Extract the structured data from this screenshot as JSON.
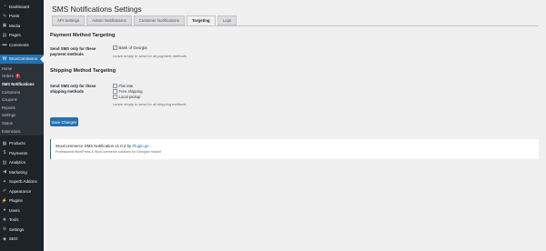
{
  "sidebar": {
    "top_items": [
      {
        "label": "Dashboard",
        "icon": "dashboard-icon",
        "glyph": "◔"
      },
      {
        "label": "Posts",
        "icon": "pushpin-icon",
        "glyph": "✎"
      },
      {
        "label": "Media",
        "icon": "media-icon",
        "glyph": "▣"
      },
      {
        "label": "Pages",
        "icon": "pages-icon",
        "glyph": "▤"
      },
      {
        "label": "Comments",
        "icon": "comments-icon",
        "glyph": "▬"
      }
    ],
    "woocommerce": {
      "label": "WooCommerce",
      "icon": "woo-icon",
      "glyph": "W"
    },
    "woo_submenu": [
      {
        "label": "Home"
      },
      {
        "label": "Orders",
        "badge": "4"
      },
      {
        "label": "SMS Notifications",
        "current": true
      },
      {
        "label": "Customers"
      },
      {
        "label": "Coupons"
      },
      {
        "label": "Reports"
      },
      {
        "label": "Settings"
      },
      {
        "label": "Status"
      },
      {
        "label": "Extensions"
      }
    ],
    "bottom_items": [
      {
        "label": "Products",
        "icon": "products-icon",
        "glyph": "▦"
      },
      {
        "label": "Payments",
        "icon": "payments-icon",
        "glyph": "$"
      },
      {
        "label": "Analytics",
        "icon": "analytics-icon",
        "glyph": "▥"
      },
      {
        "label": "Marketing",
        "icon": "marketing-icon",
        "glyph": "◀"
      },
      {
        "label": "Superb Addons",
        "icon": "addons-icon",
        "glyph": "✦"
      },
      {
        "label": "Appearance",
        "icon": "appearance-icon",
        "glyph": "✐"
      },
      {
        "label": "Plugins",
        "icon": "plugins-icon",
        "glyph": "⚡"
      },
      {
        "label": "Users",
        "icon": "users-icon",
        "glyph": "●"
      },
      {
        "label": "Tools",
        "icon": "tools-icon",
        "glyph": "✚"
      },
      {
        "label": "Settings",
        "icon": "settings-icon",
        "glyph": "⚙"
      },
      {
        "label": "SEO",
        "icon": "seo-icon",
        "glyph": "◆"
      }
    ]
  },
  "page": {
    "title": "SMS Notifications Settings",
    "tabs": [
      {
        "label": "API Settings",
        "active": false
      },
      {
        "label": "Admin Notifications",
        "active": false
      },
      {
        "label": "Customer Notifications",
        "active": false
      },
      {
        "label": "Targeting",
        "active": true
      },
      {
        "label": "Logs",
        "active": false
      }
    ]
  },
  "payment": {
    "heading": "Payment Method Targeting",
    "label": "Send SMS only for these payment methods",
    "options": [
      {
        "label": "Bank of Georgia",
        "checked": true
      }
    ],
    "description": "Leave empty to send for all payment methods"
  },
  "shipping": {
    "heading": "Shipping Method Targeting",
    "label": "Send SMS only for these shipping methods",
    "options": [
      {
        "label": "Flat rate",
        "checked": false
      },
      {
        "label": "Free shipping",
        "checked": false
      },
      {
        "label": "Local pickup",
        "checked": false
      }
    ],
    "description": "Leave empty to send for all shipping methods"
  },
  "save_label": "Save Changes",
  "notice": {
    "title_prefix": "WooCommerce SMS Notification v1.0.2 by",
    "link": "Plugin.ge",
    "subtitle": "Professional WordPress & WooCommerce solutions for Georgian market"
  },
  "colors": {
    "accent": "#2271b1",
    "sidebar_bg": "#1d2327",
    "page_bg": "#f0f0f1",
    "badge": "#d63638"
  }
}
